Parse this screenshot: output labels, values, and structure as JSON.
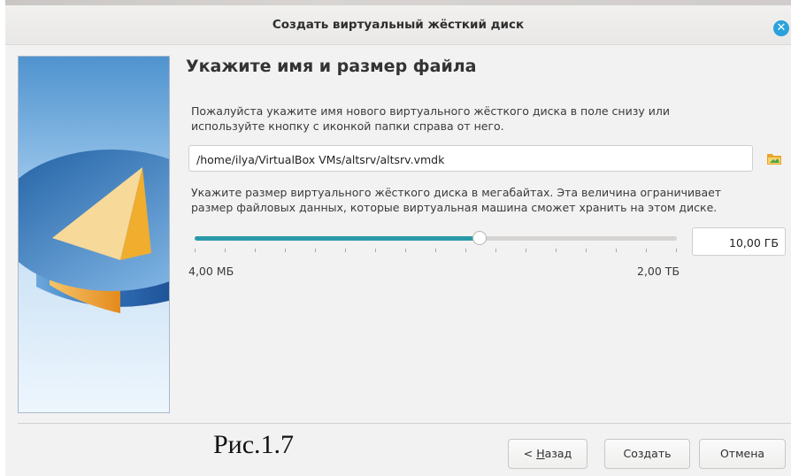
{
  "window": {
    "title": "Создать виртуальный жёсткий диск",
    "close_icon": "close-icon"
  },
  "page": {
    "heading": "Укажите имя и размер файла",
    "file_instruction_line1": "Пожалуйста укажите имя нового виртуального жёсткого диска в поле снизу или",
    "file_instruction_line2": "используйте кнопку с иконкой папки справа от него.",
    "file_path": "/home/ilya/VirtualBox VMs/altsrv/altsrv.vmdk",
    "folder_icon": "folder-icon",
    "size_instruction_line1": "Укажите размер виртуального жёсткого диска в мегабайтах. Эта величина ограничивает",
    "size_instruction_line2": "размер файловых данных, которые виртуальная машина сможет хранить на этом диске.",
    "size_value": "10,00 ГБ",
    "slider_fraction": 0.59,
    "slider_min_label": "4,00 МБ",
    "slider_max_label": "2,00 ТБ"
  },
  "caption": "Рис.1.7",
  "buttons": {
    "back_prefix": "< ",
    "back_mnemonic": "Н",
    "back_rest": "азад",
    "create": "Создать",
    "cancel": "Отмена"
  },
  "colors": {
    "accent": "#2a9aa8",
    "close": "#2aa2da"
  }
}
